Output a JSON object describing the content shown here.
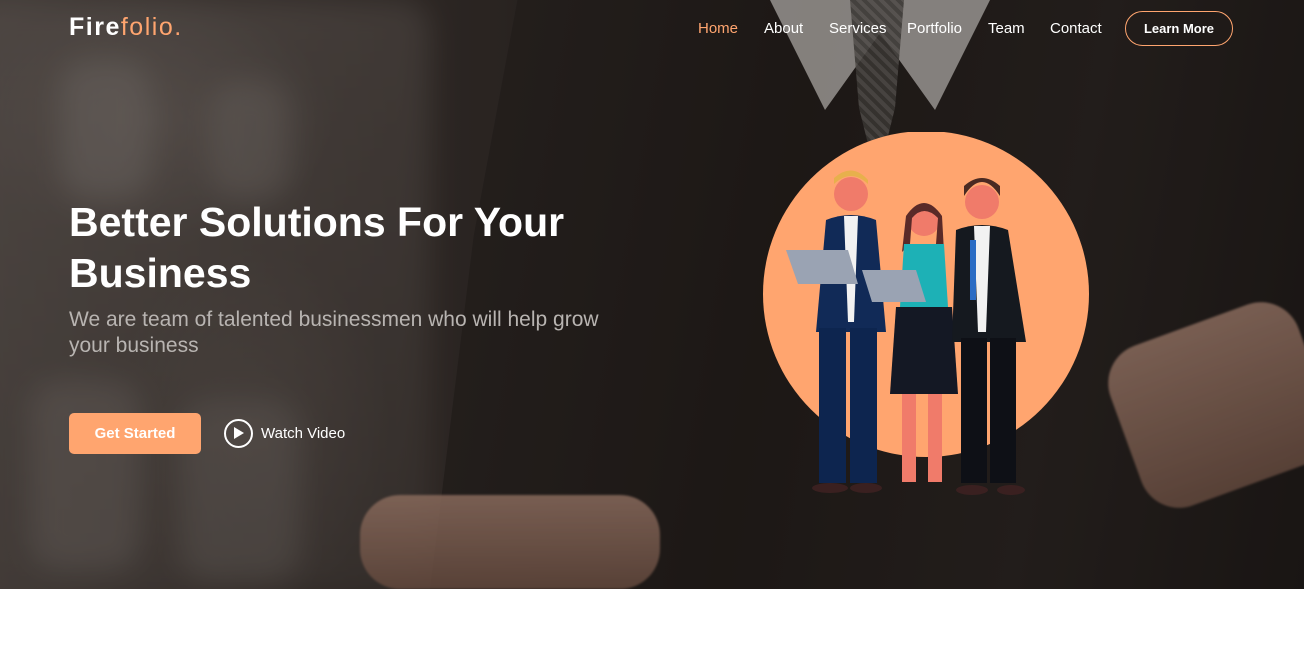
{
  "brand": {
    "name_main": "Fire",
    "name_accent": "folio."
  },
  "nav": {
    "items": [
      {
        "label": "Home",
        "active": true
      },
      {
        "label": "About",
        "active": false
      },
      {
        "label": "Services",
        "active": false
      },
      {
        "label": "Portfolio",
        "active": false
      },
      {
        "label": "Team",
        "active": false
      },
      {
        "label": "Contact",
        "active": false
      }
    ],
    "cta_label": "Learn More"
  },
  "hero": {
    "title": "Better Solutions For Your Business",
    "subtitle": "We are team of talented businessmen who will help grow your business",
    "primary_button": "Get Started",
    "secondary_button": "Watch Video",
    "illustration": "business-team-illustration",
    "background": "business-suit-photo"
  },
  "colors": {
    "accent": "#ffa56f",
    "text": "#ffffff",
    "muted": "#b8b4b1",
    "overlay": "#1f1917"
  },
  "icons": {
    "play": "play-circle-icon"
  }
}
